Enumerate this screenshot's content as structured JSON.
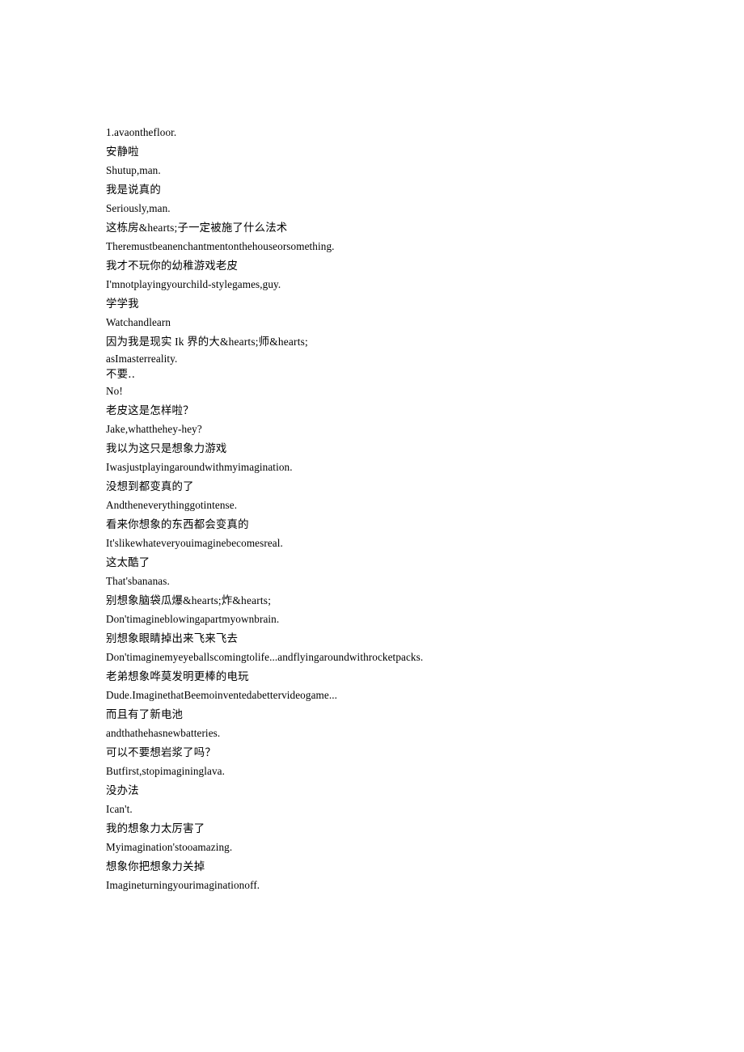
{
  "document": {
    "background_color": "#ffffff",
    "text_color": "#000000",
    "lines": [
      {
        "id": "line-1",
        "lang": "en",
        "text": "1.avaonthefloor."
      },
      {
        "id": "line-2",
        "lang": "zh",
        "text": "安静啦"
      },
      {
        "id": "line-3",
        "lang": "en",
        "text": "Shutup,man."
      },
      {
        "id": "line-4",
        "lang": "zh",
        "text": "我是说真的"
      },
      {
        "id": "line-5",
        "lang": "en",
        "text": "Seriously,man."
      },
      {
        "id": "line-6",
        "lang": "zh",
        "text": "这栋房&hearts;子一定被施了什么法术"
      },
      {
        "id": "line-7",
        "lang": "en",
        "text": "Theremustbeanenchantmentonthehouseorsomething."
      },
      {
        "id": "line-8",
        "lang": "zh",
        "text": "我才不玩你的幼稚游戏老皮"
      },
      {
        "id": "line-9",
        "lang": "en",
        "text": "I'mnotplayingyourchild-stylegames,guy."
      },
      {
        "id": "line-10",
        "lang": "zh",
        "text": "学学我"
      },
      {
        "id": "line-11",
        "lang": "en",
        "text": "Watchandlearn"
      },
      {
        "id": "line-12",
        "lang": "zh",
        "text": "因为我是现实 Ik 界的大&hearts;师&hearts;"
      },
      {
        "id": "line-13",
        "lang": "en",
        "text": "asImasterreality."
      },
      {
        "id": "line-14",
        "lang": "zh",
        "text": "不要‥"
      },
      {
        "id": "line-15",
        "lang": "en",
        "text": "No!"
      },
      {
        "id": "line-16",
        "lang": "zh",
        "text": "老皮这是怎样啦？"
      },
      {
        "id": "line-17",
        "lang": "en",
        "text": "Jake,whatthehey-hey?"
      },
      {
        "id": "line-18",
        "lang": "zh",
        "text": "我以为这只是想象力游戏"
      },
      {
        "id": "line-19",
        "lang": "en",
        "text": "Iwasjustplayingaroundwithmyimagination."
      },
      {
        "id": "line-20",
        "lang": "zh",
        "text": "没想到都变真的了"
      },
      {
        "id": "line-21",
        "lang": "en",
        "text": "Andtheneverythinggotintense."
      },
      {
        "id": "line-22",
        "lang": "zh",
        "text": "看来你想象的东西都会变真的"
      },
      {
        "id": "line-23",
        "lang": "en",
        "text": "It'slikewhateveryouimaginebecomesreal."
      },
      {
        "id": "line-24",
        "lang": "zh",
        "text": "这太酷了"
      },
      {
        "id": "line-25",
        "lang": "en",
        "text": "That'sbananas."
      },
      {
        "id": "line-26",
        "lang": "zh",
        "text": "别想象脑袋瓜爆&hearts;炸&hearts;"
      },
      {
        "id": "line-27",
        "lang": "en",
        "text": "Don'timagineblowingapartmyownbrain."
      },
      {
        "id": "line-28",
        "lang": "zh",
        "text": "别想象眼睛掉出来飞来飞去"
      },
      {
        "id": "line-29",
        "lang": "en",
        "text": "Don'timaginemyeyeballscomingtolife...andflyingaroundwithrocketpacks."
      },
      {
        "id": "line-30",
        "lang": "zh",
        "text": "老弟想象哗莫发明更棒的电玩"
      },
      {
        "id": "line-31",
        "lang": "en",
        "text": "Dude.ImaginethatBeemoinventedabettervideogame..."
      },
      {
        "id": "line-32",
        "lang": "zh",
        "text": "而且有了新电池"
      },
      {
        "id": "line-33",
        "lang": "en",
        "text": "andthathehasnewbatteries."
      },
      {
        "id": "line-34",
        "lang": "zh",
        "text": "可以不要想岩浆了吗？"
      },
      {
        "id": "line-35",
        "lang": "en",
        "text": "Butfirst,stopimagininglava."
      },
      {
        "id": "line-36",
        "lang": "zh",
        "text": "没办法"
      },
      {
        "id": "line-37",
        "lang": "en",
        "text": "Ican't."
      },
      {
        "id": "line-38",
        "lang": "zh",
        "text": "我的想象力太厉害了"
      },
      {
        "id": "line-39",
        "lang": "en",
        "text": "Myimagination'stooamazing."
      },
      {
        "id": "line-40",
        "lang": "zh",
        "text": "想象你把想象力关掉"
      },
      {
        "id": "line-41",
        "lang": "en",
        "text": "Imagineturningyourimaginationoff."
      }
    ]
  }
}
